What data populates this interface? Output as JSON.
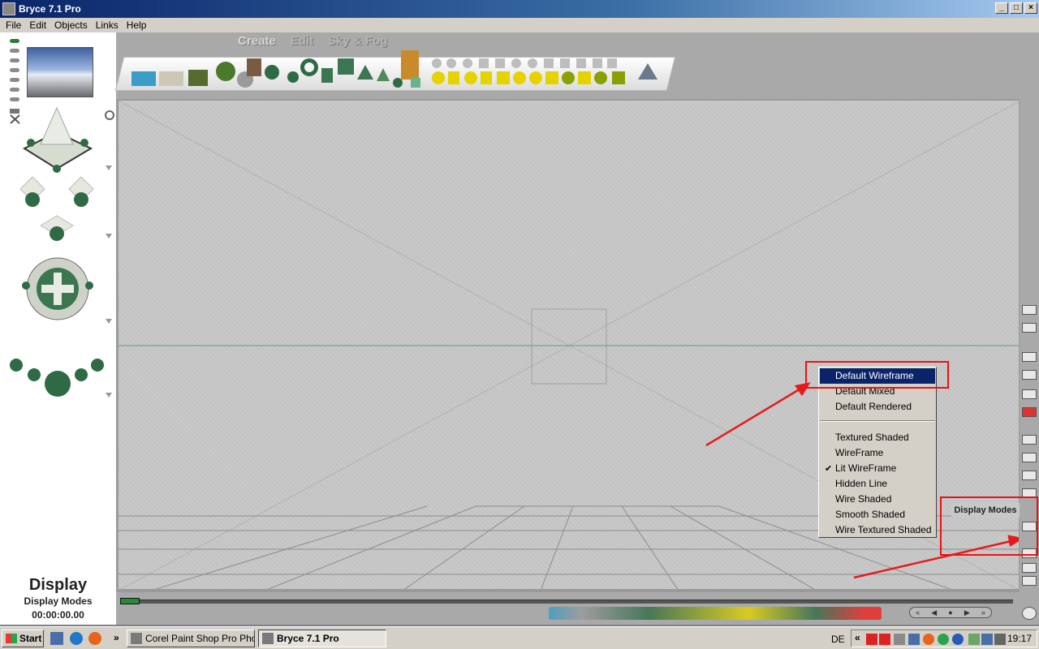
{
  "window": {
    "title": "Bryce 7.1  Pro",
    "min": "_",
    "max": "□",
    "close": "×"
  },
  "menu": [
    "File",
    "Edit",
    "Objects",
    "Links",
    "Help"
  ],
  "palette_tabs": [
    "Create",
    "Edit",
    "Sky & Fog"
  ],
  "left_panel": {
    "title": "Display",
    "subtitle": "Display Modes",
    "timecode": "00:00:00.00"
  },
  "popup": {
    "group1": [
      "Default Wireframe",
      "Default Mixed",
      "Default Rendered"
    ],
    "group2": [
      "Textured Shaded",
      "WireFrame",
      "Lit WireFrame",
      "Hidden Line",
      "Wire Shaded",
      "Smooth Shaded",
      "Wire Textured Shaded"
    ],
    "selected": "Default Wireframe",
    "checked": "Lit WireFrame",
    "check_mark": "✔"
  },
  "tooltip": "Display Modes",
  "anim_controls": [
    "«",
    "◀",
    "●",
    "▶",
    "»"
  ],
  "colors": {
    "highlight": "#0a246a",
    "annotation_red": "#ee1111",
    "accent_green": "#2b8a3a"
  },
  "taskbar": {
    "start": "Start",
    "chevron": "»",
    "tasks": [
      {
        "label": "Corel Paint Shop Pro Pho...",
        "active": false
      },
      {
        "label": "Bryce 7.1  Pro",
        "active": true
      }
    ],
    "language": "DE",
    "tray_chevron": "«",
    "clock": "19:17"
  }
}
